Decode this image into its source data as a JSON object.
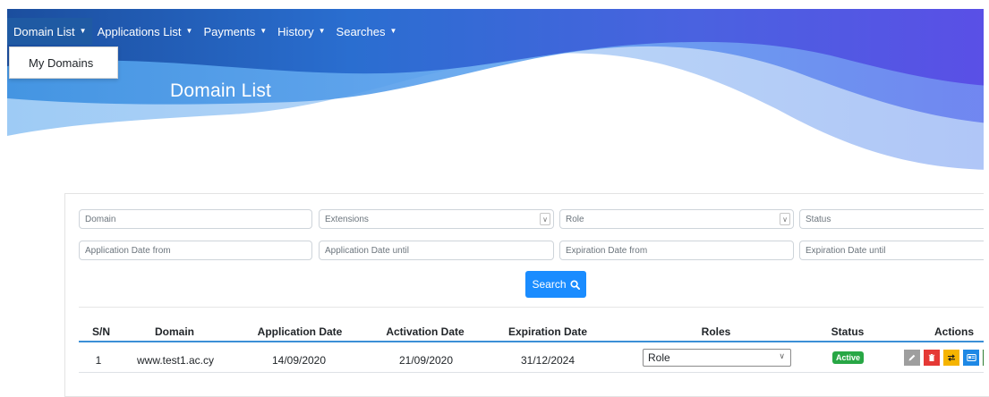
{
  "nav": {
    "items": [
      {
        "label": "Domain List"
      },
      {
        "label": "Applications List"
      },
      {
        "label": "Payments"
      },
      {
        "label": "History"
      },
      {
        "label": "Searches"
      }
    ],
    "dropdown": {
      "items": [
        {
          "label": "My Domains"
        }
      ]
    }
  },
  "page": {
    "title": "Domain List"
  },
  "filters": {
    "domain_placeholder": "Domain",
    "extensions_placeholder": "Extensions",
    "role_placeholder": "Role",
    "status_placeholder": "Status",
    "app_date_from_placeholder": "Application Date from",
    "app_date_until_placeholder": "Application Date until",
    "exp_date_from_placeholder": "Expiration Date from",
    "exp_date_until_placeholder": "Expiration Date until",
    "search_label": "Search"
  },
  "table": {
    "headers": [
      "S/N",
      "Domain",
      "Application Date",
      "Activation Date",
      "Expiration Date",
      "Roles",
      "Status",
      "Actions"
    ],
    "rows": [
      {
        "sn": "1",
        "domain": "www.test1.ac.cy",
        "application_date": "14/09/2020",
        "activation_date": "21/09/2020",
        "expiration_date": "31/12/2024",
        "role": "Role",
        "status": "Active"
      }
    ]
  },
  "actions": [
    {
      "icon": "pencil-icon",
      "color": "#9e9e9e"
    },
    {
      "icon": "trash-icon",
      "color": "#e53935"
    },
    {
      "icon": "swap-icon",
      "color": "#f5b400"
    },
    {
      "icon": "id-card-icon",
      "color": "#1e88e5"
    }
  ],
  "colors": {
    "accent": "#1a8cff",
    "nav_active": "#1f5aa3",
    "status_active": "#28a745",
    "table_header_line": "#3b8fd6"
  }
}
